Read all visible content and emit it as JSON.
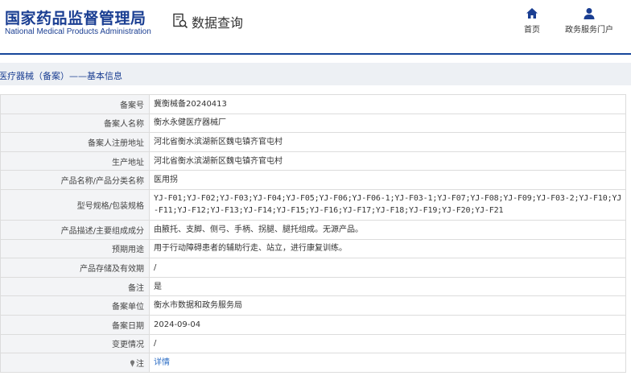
{
  "header": {
    "logo_cn": "国家药品监督管理局",
    "logo_en": "National Medical Products Administration",
    "query_title": "数据查询",
    "nav": {
      "home_label": "首页",
      "portal_label": "政务服务门户"
    }
  },
  "section": {
    "title": "医疗器械（备案）——基本信息"
  },
  "colors": {
    "brand": "#1a3e92",
    "header_line": "#16479b",
    "label_bg": "#f3f4f6",
    "section_bg": "#edf0f4",
    "link": "#2b6cc4"
  },
  "table": {
    "rows": [
      {
        "label": "备案号",
        "value": "冀衡械备20240413"
      },
      {
        "label": "备案人名称",
        "value": "衡水永健医疗器械厂"
      },
      {
        "label": "备案人注册地址",
        "value": "河北省衡水滨湖新区魏屯镇齐官屯村"
      },
      {
        "label": "生产地址",
        "value": "河北省衡水滨湖新区魏屯镇齐官屯村"
      },
      {
        "label": "产品名称/产品分类名称",
        "value": "医用拐"
      },
      {
        "label": "型号规格/包装规格",
        "value": "YJ-F01;YJ-F02;YJ-F03;YJ-F04;YJ-F05;YJ-F06;YJ-F06-1;YJ-F03-1;YJ-F07;YJ-F08;YJ-F09;YJ-F03-2;YJ-F10;YJ-F11;YJ-F12;YJ-F13;YJ-F14;YJ-F15;YJ-F16;YJ-F17;YJ-F18;YJ-F19;YJ-F20;YJ-F21"
      },
      {
        "label": "产品描述/主要组成成分",
        "value": "由腋托、支脚、侧弓、手柄、拐腿、腿托组成。无源产品。"
      },
      {
        "label": "预期用途",
        "value": "用于行动障碍患者的辅助行走、站立，进行康复训练。"
      },
      {
        "label": "产品存储及有效期",
        "value": "/"
      },
      {
        "label": "备注",
        "value": "是"
      },
      {
        "label": "备案单位",
        "value": "衡水市数据和政务服务局"
      },
      {
        "label": "备案日期",
        "value": "2024-09-04"
      },
      {
        "label": "变更情况",
        "value": "/"
      },
      {
        "label": "注",
        "value": "详情"
      }
    ]
  }
}
